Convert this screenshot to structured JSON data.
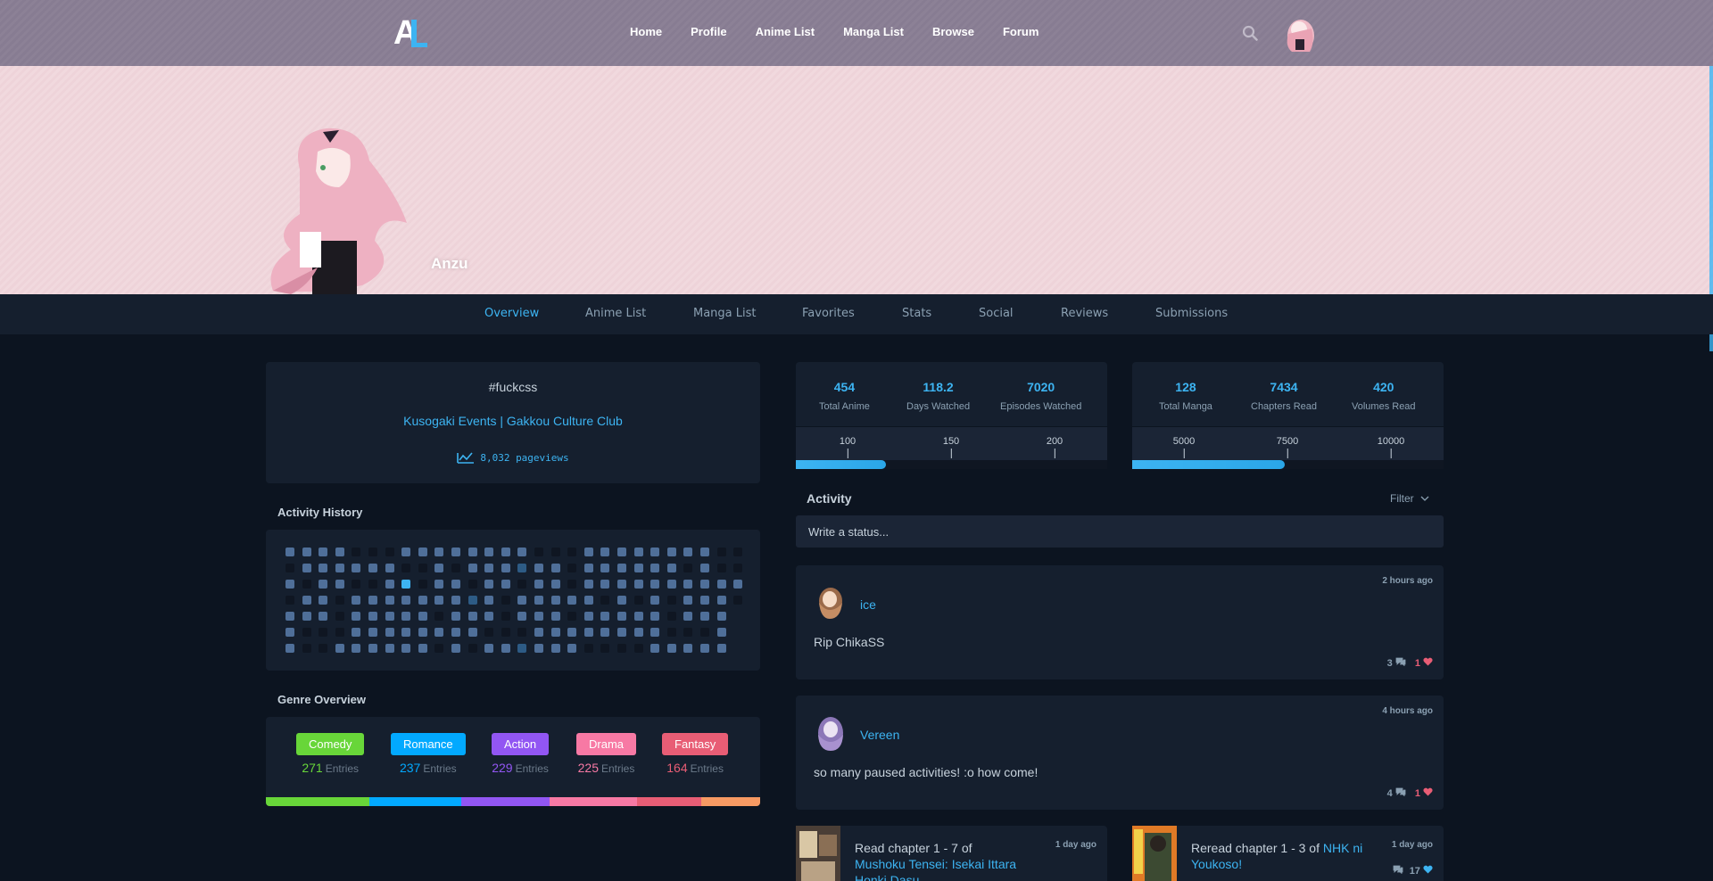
{
  "nav": {
    "links": [
      "Home",
      "Profile",
      "Anime List",
      "Manga List",
      "Browse",
      "Forum"
    ]
  },
  "banner": {
    "username": "Anzu"
  },
  "profile_tabs": [
    "Overview",
    "Anime List",
    "Manga List",
    "Favorites",
    "Stats",
    "Social",
    "Reviews",
    "Submissions"
  ],
  "about": {
    "line1": "#fuckcss",
    "line2": "Kusogaki Events | Gakkou Culture Club",
    "pageviews": "8,032 pageviews"
  },
  "activity_history": {
    "title": "Activity History"
  },
  "genre_overview": {
    "title": "Genre Overview",
    "entries_label": "Entries",
    "genres": [
      {
        "name": "Comedy",
        "count": "271",
        "color": "#68d639",
        "share": 0.21
      },
      {
        "name": "Romance",
        "count": "237",
        "color": "#02a9ff",
        "share": 0.186
      },
      {
        "name": "Action",
        "count": "229",
        "color": "#9256f3",
        "share": 0.178
      },
      {
        "name": "Drama",
        "count": "225",
        "color": "#f779a4",
        "share": 0.176
      },
      {
        "name": "Fantasy",
        "count": "164",
        "color": "#e85d75",
        "share": 0.13
      },
      {
        "name": "",
        "count": "",
        "color": "#f79a63",
        "share": 0.12
      }
    ]
  },
  "anime_stats": {
    "total": {
      "value": "454",
      "label": "Total Anime"
    },
    "days": {
      "value": "118.2",
      "label": "Days Watched"
    },
    "episodes": {
      "value": "7020",
      "label": "Episodes Watched"
    },
    "ticks": [
      "100",
      "150",
      "200"
    ],
    "progress": 0.29
  },
  "manga_stats": {
    "total": {
      "value": "128",
      "label": "Total Manga"
    },
    "chapters": {
      "value": "7434",
      "label": "Chapters Read"
    },
    "volumes": {
      "value": "420",
      "label": "Volumes Read"
    },
    "ticks": [
      "5000",
      "7500",
      "10000"
    ],
    "progress": 0.49
  },
  "activity": {
    "title": "Activity",
    "filter": "Filter",
    "status_placeholder": "Write a status..."
  },
  "posts": [
    {
      "user": "ice",
      "time": "2 hours ago",
      "text": "Rip ChikaSS",
      "replies": "3",
      "likes": "1"
    },
    {
      "user": "Vereen",
      "time": "4 hours ago",
      "text": "so many paused activities! :o how come!",
      "replies": "4",
      "likes": "1"
    }
  ],
  "list_updates": [
    {
      "prefix": "Read chapter 1 - 7 of",
      "title": "Mushoku Tensei: Isekai Ittara Honki Dasu",
      "time": "1 day ago",
      "count": ""
    },
    {
      "prefix": "Reread chapter 1 - 3 of",
      "title": "NHK ni Youkoso!",
      "time": "1 day ago",
      "count": "17"
    }
  ],
  "colors": {
    "accent": "#3db4f2",
    "like": "#e85d75"
  }
}
